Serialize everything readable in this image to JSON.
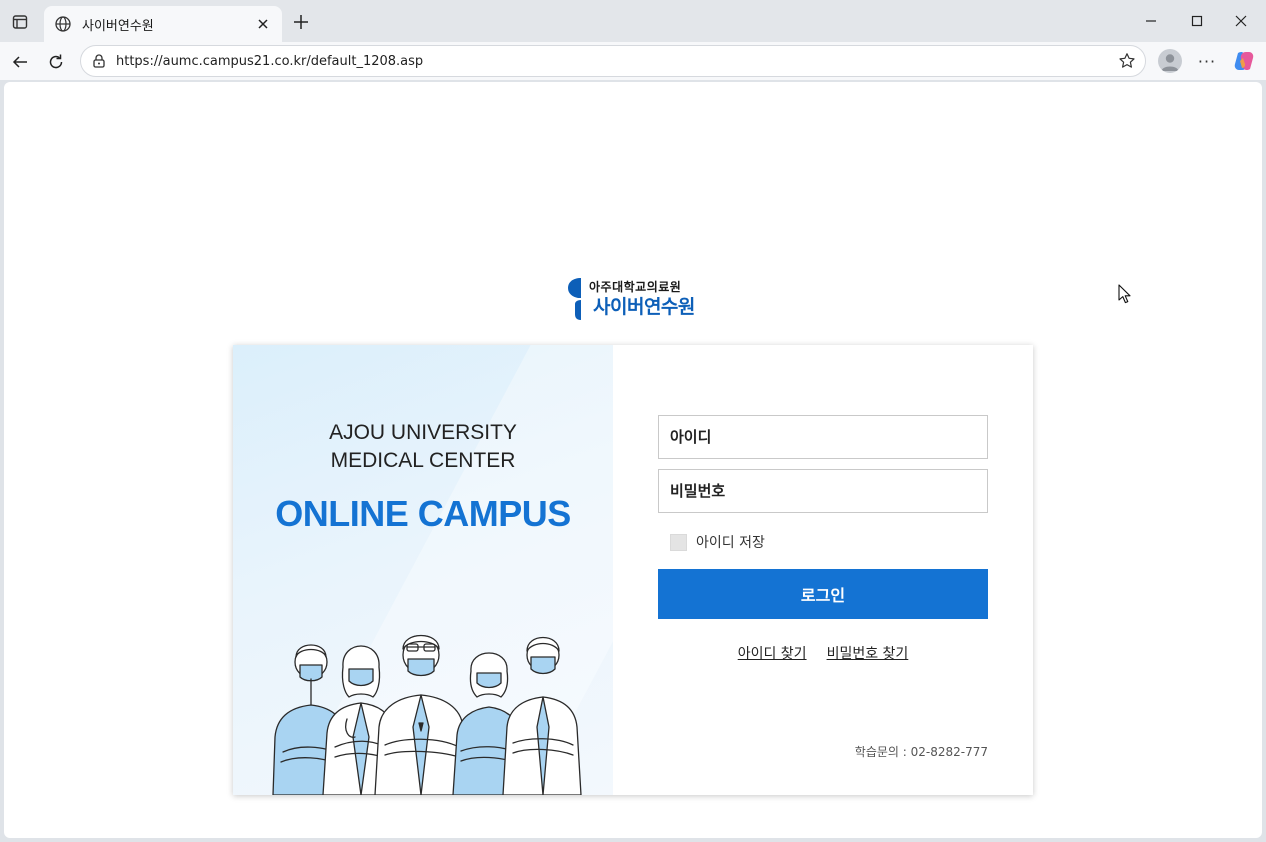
{
  "browser": {
    "tab_title": "사이버연수원",
    "url": "https://aumc.campus21.co.kr/default_1208.asp",
    "more_label": "···"
  },
  "logo": {
    "line1": "아주대학교의료원",
    "line2": "사이버연수원"
  },
  "hero": {
    "line1": "AJOU UNIVERSITY",
    "line2": "MEDICAL CENTER",
    "title": "ONLINE CAMPUS"
  },
  "login": {
    "id_placeholder": "아이디",
    "pw_placeholder": "비밀번호",
    "remember_label": "아이디 저장",
    "submit_label": "로그인",
    "find_id_label": "아이디 찾기",
    "find_pw_label": "비밀번호 찾기",
    "contact": "학습문의 : 02-8282-777"
  },
  "colors": {
    "brand_blue": "#1473d3",
    "logo_blue": "#0d5fb8"
  },
  "icons": [
    "tab-actions-icon",
    "globe-icon",
    "close-icon",
    "plus-icon",
    "minimize-icon",
    "maximize-icon",
    "back-icon",
    "reload-icon",
    "lock-icon",
    "star-icon",
    "profile-icon",
    "copilot-icon"
  ]
}
